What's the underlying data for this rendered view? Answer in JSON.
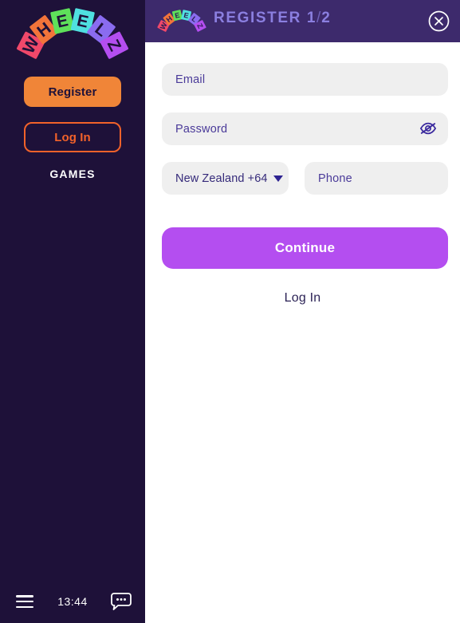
{
  "brand": {
    "name": "WHEELZ",
    "letters": [
      "W",
      "H",
      "E",
      "E",
      "L",
      "Z"
    ],
    "letter_colors": [
      "#f0486a",
      "#f2743a",
      "#5ee05a",
      "#4fe0e0",
      "#8a6cf0",
      "#b44ef0"
    ]
  },
  "sidebar": {
    "register_label": "Register",
    "login_label": "Log In",
    "games_label": "GAMES",
    "register_bg": "#f08538",
    "login_border": "#f2622a",
    "background": "#1e1139"
  },
  "bottom_bar": {
    "menu_icon": "hamburger-menu-icon",
    "time": "13:44",
    "chat_icon": "chat-bubble-icon"
  },
  "modal": {
    "header": {
      "title": "REGISTER",
      "step_current": "1",
      "step_separator": "/",
      "step_total": "2",
      "logo_icon": "wheelz-logo-icon",
      "close_icon": "close-circle-icon",
      "background": "#3d2a6c",
      "title_color": "#8b7fe0"
    },
    "form": {
      "email": {
        "label": "Email",
        "placeholder": "Email",
        "value": ""
      },
      "password": {
        "label": "Password",
        "placeholder": "Password",
        "value": "",
        "toggle_icon": "eye-slash-icon"
      },
      "country": {
        "selected": "New Zealand +64",
        "chevron_icon": "chevron-down-icon"
      },
      "phone": {
        "label": "Phone",
        "placeholder": "Phone",
        "value": ""
      },
      "continue_label": "Continue",
      "continue_bg": "#b44ef0",
      "login_link_label": "Log In"
    }
  }
}
